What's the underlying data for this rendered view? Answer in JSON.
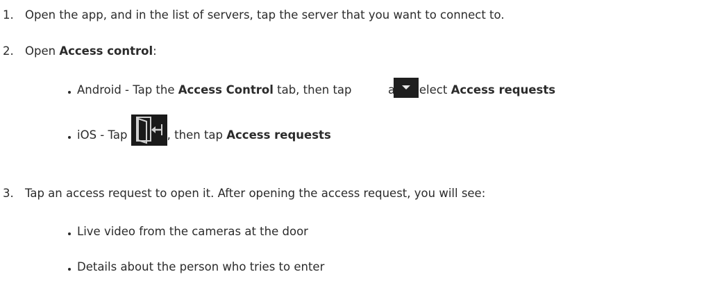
{
  "steps": [
    {
      "number": "1.",
      "text": "Open the app, and in the list of servers, tap the server that you want to connect to."
    },
    {
      "number": "2.",
      "text_before": "Open ",
      "bold": "Access control",
      "text_after": ":",
      "bullets": {
        "android": {
          "text_before": "Android - Tap the ",
          "bold_1": "Access Control",
          "text_mid": " tab, then tap ",
          "icon": "dropdown-arrow-icon",
          "text_after": " and select ",
          "bold_2": "Access requests"
        },
        "ios": {
          "text_before": "iOS - Tap ",
          "icon": "door-exit-icon",
          "text_after": ", then tap ",
          "bold": "Access requests"
        }
      }
    },
    {
      "number": "3.",
      "text": "Tap an access request to open it. After opening the access request, you will see:",
      "bullets": [
        "Live video from the cameras at the door",
        "Details about the person who tries to enter"
      ]
    }
  ]
}
